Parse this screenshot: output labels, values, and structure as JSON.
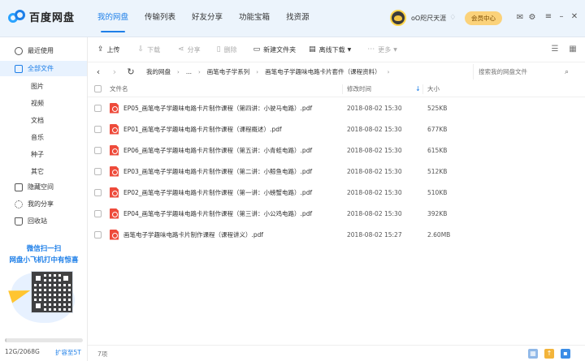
{
  "app": {
    "name": "百度网盘"
  },
  "nav": {
    "tabs": [
      {
        "label": "我的网盘",
        "active": true
      },
      {
        "label": "传输列表"
      },
      {
        "label": "好友分享"
      },
      {
        "label": "功能宝箱"
      },
      {
        "label": "找资源"
      }
    ]
  },
  "user": {
    "name": "oO咫尺天涯",
    "vip_label": "会员中心"
  },
  "sidebar": {
    "items": [
      {
        "label": "最近使用",
        "icon": "clock-icon"
      },
      {
        "label": "全部文件",
        "icon": "folder-icon",
        "active": true
      },
      {
        "label": "隐藏空间",
        "icon": "lock-icon"
      },
      {
        "label": "我的分享",
        "icon": "share-icon"
      },
      {
        "label": "回收站",
        "icon": "trash-icon"
      }
    ],
    "subitems": [
      "图片",
      "视频",
      "文档",
      "音乐",
      "种子",
      "其它"
    ],
    "promo": {
      "line1": "微信扫一扫",
      "line2": "网盘小飞机打中有惊喜"
    },
    "storage": {
      "text": "12G/2068G",
      "used_fraction": 0.006,
      "expand_label": "扩容至5T"
    }
  },
  "toolbar": {
    "upload": "上传",
    "download": "下载",
    "share": "分享",
    "delete": "删除",
    "new_folder": "新建文件夹",
    "offline_download": "离线下载",
    "more": "更多"
  },
  "path": {
    "crumbs": [
      "我的网盘",
      "...",
      "画笔电子学系列",
      "画笔电子学趣味电路卡片套件（课程资料）"
    ],
    "search_placeholder": "搜索我的网盘文件"
  },
  "table": {
    "headers": {
      "name": "文件名",
      "date": "修改时间",
      "size": "大小"
    },
    "rows": [
      {
        "name": "EP05_画笔电子学趣味电路卡片制作课程（第四讲：小驶马电路）.pdf",
        "date": "2018-08-02 15:30",
        "size": "525KB"
      },
      {
        "name": "EP01_画笔电子学趣味电路卡片制作课程（课程概述）.pdf",
        "date": "2018-08-02 15:30",
        "size": "677KB"
      },
      {
        "name": "EP06_画笔电子学趣味电路卡片制作课程（第五讲：小青蛙电路）.pdf",
        "date": "2018-08-02 15:30",
        "size": "615KB"
      },
      {
        "name": "EP03_画笔电子学趣味电路卡片制作课程（第二讲：小鲸鱼电路）.pdf",
        "date": "2018-08-02 15:30",
        "size": "512KB"
      },
      {
        "name": "EP02_画笔电子学趣味电路卡片制作课程（第一讲：小螃蟹电路）.pdf",
        "date": "2018-08-02 15:30",
        "size": "510KB"
      },
      {
        "name": "EP04_画笔电子学趣味电路卡片制作课程（第三讲：小公鸡电路）.pdf",
        "date": "2018-08-02 15:30",
        "size": "392KB"
      },
      {
        "name": "画笔电子学趣味电路卡片制作课程（课程讲义）.pdf",
        "date": "2018-08-02 15:27",
        "size": "2.60MB"
      }
    ]
  },
  "status": {
    "count": "7项"
  },
  "colors": {
    "accent": "#1e7fe8",
    "pdf": "#ee4b3b",
    "vip": "#fbd27a"
  }
}
